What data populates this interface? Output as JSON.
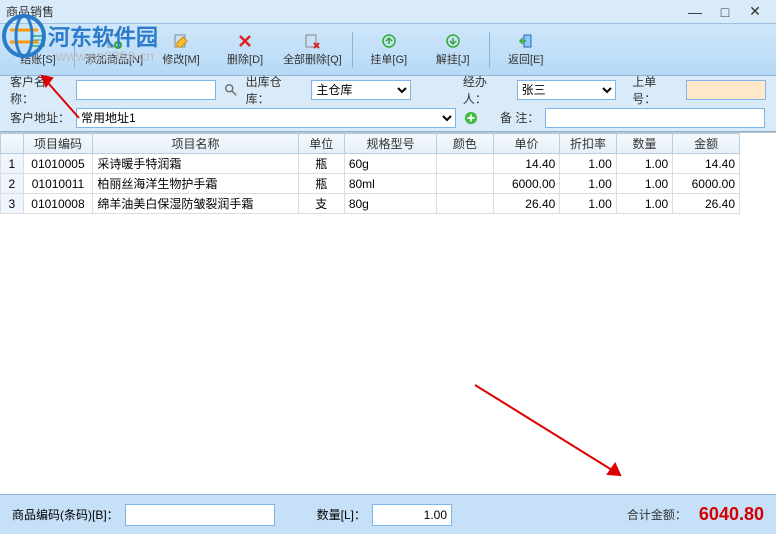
{
  "window": {
    "title": "商品销售"
  },
  "watermark": {
    "brand": "河东软件园",
    "url": "www.pc0359.cn"
  },
  "toolbar": {
    "checkout_label": "结账[S]",
    "add_label": "添加商品[N]",
    "edit_label": "修改[M]",
    "delete_label": "删除[D]",
    "delete_all_label": "全部删除[Q]",
    "hold_label": "挂单[G]",
    "release_label": "解挂[J]",
    "return_label": "返回[E]"
  },
  "form": {
    "customer_name_label": "客户名称：",
    "customer_name_value": "",
    "warehouse_label": "出库仓库：",
    "warehouse_value": "主仓库",
    "operator_label": "经办人：",
    "operator_value": "张三",
    "prev_order_label": "上单号：",
    "prev_order_value": "",
    "customer_addr_label": "客户地址：",
    "customer_addr_value": "常用地址1",
    "remark_label": "备  注："
  },
  "table": {
    "headers": {
      "code": "项目编码",
      "name": "项目名称",
      "unit": "单位",
      "spec": "规格型号",
      "color": "颜色",
      "price": "单价",
      "discount": "折扣率",
      "qty": "数量",
      "amount": "金额"
    },
    "rows": [
      {
        "n": "1",
        "code": "01010005",
        "name": "采诗暖手特润霜",
        "unit": "瓶",
        "spec": "60g",
        "color": "",
        "price": "14.40",
        "discount": "1.00",
        "qty": "1.00",
        "amount": "14.40"
      },
      {
        "n": "2",
        "code": "01010011",
        "name": "柏丽丝海洋生物护手霜",
        "unit": "瓶",
        "spec": "80ml",
        "color": "",
        "price": "6000.00",
        "discount": "1.00",
        "qty": "1.00",
        "amount": "6000.00"
      },
      {
        "n": "3",
        "code": "01010008",
        "name": "绵羊油美白保湿防皱裂润手霜",
        "unit": "支",
        "spec": "80g",
        "color": "",
        "price": "26.40",
        "discount": "1.00",
        "qty": "1.00",
        "amount": "26.40"
      }
    ]
  },
  "bottom": {
    "barcode_label": "商品编码(条码)[B]：",
    "barcode_value": "",
    "qty_label": "数量[L]：",
    "qty_value": "1.00",
    "total_label": "合计金额：",
    "total_value": "6040.80"
  },
  "chart_data": {
    "type": "table",
    "title": "商品销售",
    "columns": [
      "项目编码",
      "项目名称",
      "单位",
      "规格型号",
      "颜色",
      "单价",
      "折扣率",
      "数量",
      "金额"
    ],
    "rows": [
      [
        "01010005",
        "采诗暖手特润霜",
        "瓶",
        "60g",
        "",
        14.4,
        1.0,
        1.0,
        14.4
      ],
      [
        "01010011",
        "柏丽丝海洋生物护手霜",
        "瓶",
        "80ml",
        "",
        6000.0,
        1.0,
        1.0,
        6000.0
      ],
      [
        "01010008",
        "绵羊油美白保湿防皱裂润手霜",
        "支",
        "80g",
        "",
        26.4,
        1.0,
        1.0,
        26.4
      ]
    ],
    "total": 6040.8
  }
}
